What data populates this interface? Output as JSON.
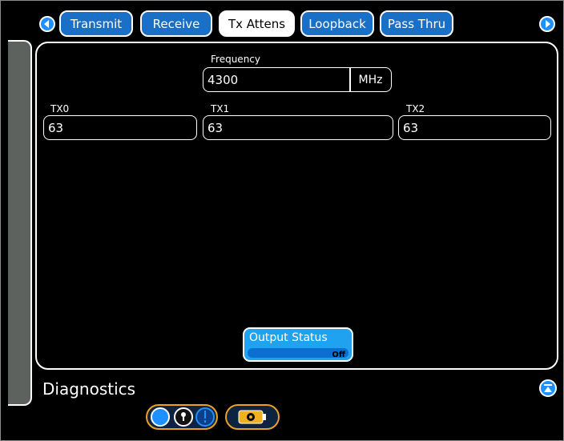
{
  "tabs": [
    {
      "label": "Transmit",
      "active": false
    },
    {
      "label": "Receive",
      "active": false
    },
    {
      "label": "Tx Attens",
      "active": true
    },
    {
      "label": "Loopback",
      "active": false
    },
    {
      "label": "Pass Thru",
      "active": false
    }
  ],
  "nav": {
    "prev_icon": "arrow-left-icon",
    "next_icon": "arrow-right-icon"
  },
  "frequency": {
    "label": "Frequency",
    "value": "4300",
    "unit": "MHz"
  },
  "channels": [
    {
      "label": "TX0",
      "value": "63"
    },
    {
      "label": "TX1",
      "value": "63"
    },
    {
      "label": "TX2",
      "value": "63"
    }
  ],
  "output": {
    "label": "Output Status",
    "state": "Off"
  },
  "footer": {
    "title": "Diagnostics",
    "collapse_icon": "collapse-up-icon"
  },
  "colors": {
    "accent": "#1a6fc6",
    "highlight": "#1fa2ef",
    "pill_border": "#f0a020",
    "sidebar": "#5e625e"
  }
}
